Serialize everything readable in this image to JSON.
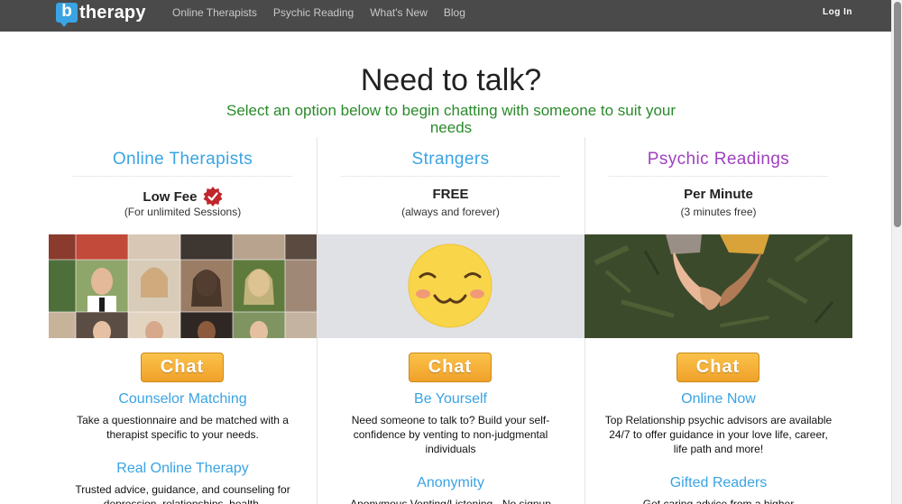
{
  "nav": {
    "logo_letter": "b",
    "logo_text": "therapy",
    "links": [
      "Online Therapists",
      "Psychic Reading",
      "What's New",
      "Blog"
    ],
    "login": "Log In"
  },
  "hero": {
    "title": "Need to talk?",
    "subtitle": "Select an option below to begin chatting with someone to suit your needs"
  },
  "colors": {
    "therapists": "#3aa3e3",
    "strangers": "#3aa3e3",
    "psychic": "#a040c0",
    "subtitle_green": "#2a8a2a",
    "button_orange": "#f5b23a"
  },
  "columns": [
    {
      "title": "Online Therapists",
      "price": "Low Fee",
      "price_note": "(For unlimited Sessions)",
      "image": "therapist-faces-grid",
      "button": "Chat",
      "features": [
        {
          "title": "Counselor Matching",
          "text": "Take a questionnaire and be matched with a therapist specific to your needs."
        },
        {
          "title": "Real Online Therapy",
          "text": "Trusted advice, guidance, and counseling for depression, relationships, health,"
        }
      ]
    },
    {
      "title": "Strangers",
      "price": "FREE",
      "price_note": "(always and forever)",
      "image": "smiley-face",
      "button": "Chat",
      "features": [
        {
          "title": "Be Yourself",
          "text": "Need someone to talk to? Build your self-confidence by venting to non-judgmental individuals"
        },
        {
          "title": "Anonymity",
          "text": "Anonymous Venting/Listening - No signup"
        }
      ]
    },
    {
      "title": "Psychic Readings",
      "price": "Per Minute",
      "price_note": "(3 minutes free)",
      "image": "holding-hands-grass",
      "button": "Chat",
      "features": [
        {
          "title": "Online Now",
          "text": "Top Relationship psychic advisors are available 24/7 to offer guidance in your love life, career, life path and more!"
        },
        {
          "title": "Gifted Readers",
          "text": "Get caring advice from a higher"
        }
      ]
    }
  ]
}
